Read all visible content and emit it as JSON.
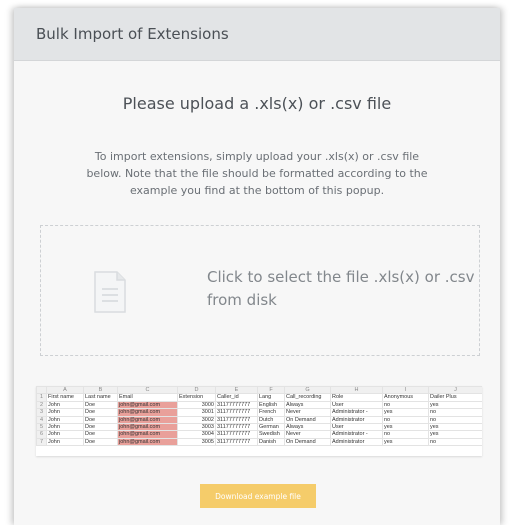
{
  "modal": {
    "title": "Bulk Import of Extensions",
    "subtitle": "Please upload a .xls(x) or .csv file",
    "description": "To import extensions, simply upload your .xls(x) or .csv file below. Note that the file should be formatted according to the example you find at the bottom of this popup."
  },
  "dropzone": {
    "icon": "document-icon",
    "text": "Click to select the file .xls(x) or .csv from disk"
  },
  "example_sheet": {
    "column_letters": [
      "A",
      "B",
      "C",
      "D",
      "E",
      "F",
      "G",
      "H",
      "I",
      "J"
    ],
    "headers": [
      "First name",
      "Last name",
      "Email",
      "Extension",
      "Caller_id",
      "Lang",
      "Call_recording",
      "Role",
      "Anonymous",
      "Dailer Plus"
    ],
    "rows": [
      [
        "John",
        "Doe",
        "john@gmail.com",
        "3000",
        "31177777777",
        "English",
        "Always",
        "User",
        "no",
        "yes"
      ],
      [
        "John",
        "Doe",
        "john@gmail.com",
        "3001",
        "31177777777",
        "French",
        "Never",
        "Administrator -",
        "yes",
        "no"
      ],
      [
        "John",
        "Doe",
        "john@gmail.com",
        "3002",
        "31177777777",
        "Dutch",
        "On Demand",
        "Administrator",
        "no",
        "no"
      ],
      [
        "John",
        "Doe",
        "john@gmail.com",
        "3003",
        "31177777777",
        "German",
        "Always",
        "User",
        "yes",
        "yes"
      ],
      [
        "John",
        "Doe",
        "john@gmail.com",
        "3004",
        "31177777777",
        "Swedish",
        "Never",
        "Administrator -",
        "no",
        "yes"
      ],
      [
        "John",
        "Doe",
        "john@gmail.com",
        "3005",
        "31177777777",
        "Danish",
        "On Demand",
        "Administrator",
        "yes",
        "no"
      ]
    ]
  },
  "download_button": {
    "label": "Download example file"
  },
  "colors": {
    "header_bg": "#e2e4e6",
    "modal_bg": "#f7f7f7",
    "button_bg": "#f5cc6a",
    "email_highlight": "#e9a09a"
  }
}
